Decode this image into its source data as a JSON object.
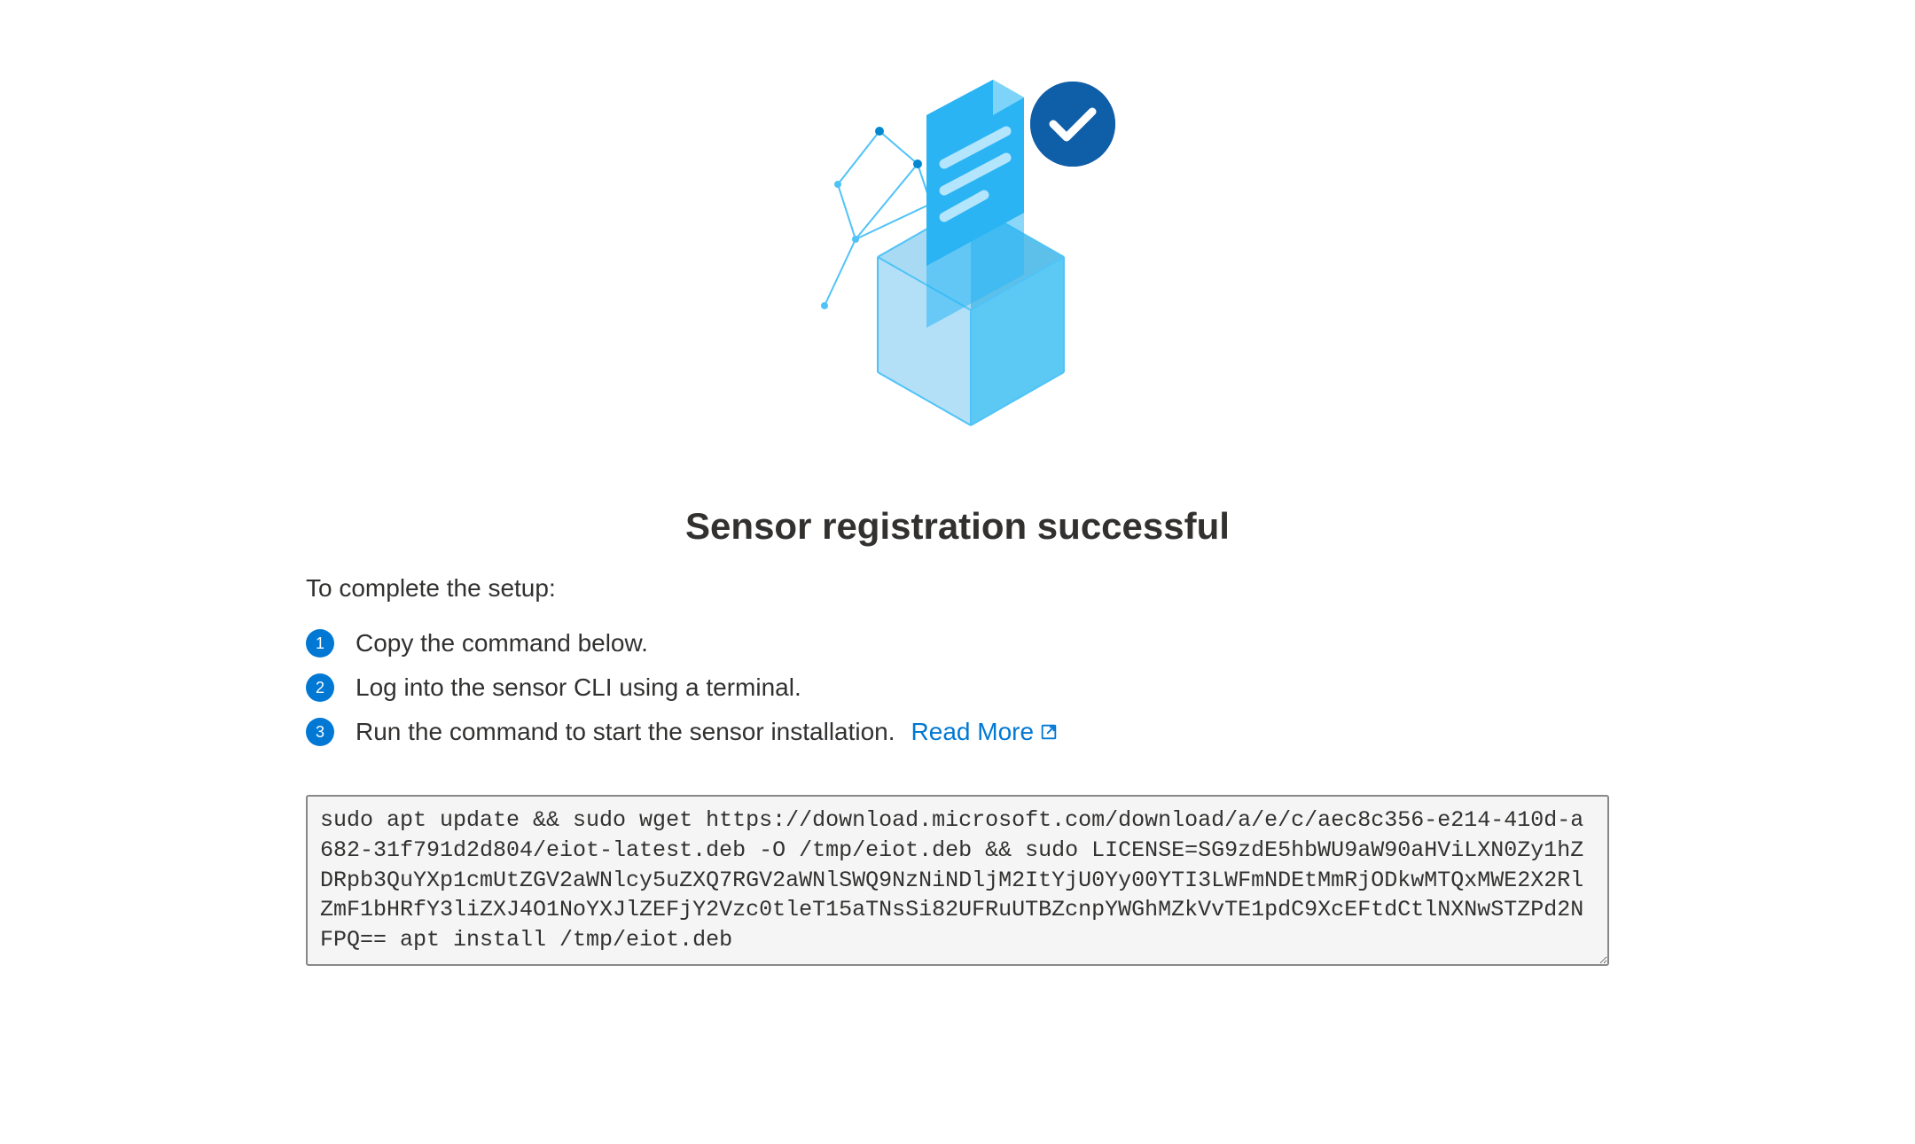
{
  "title": "Sensor registration successful",
  "subtitle": "To complete the setup:",
  "steps": [
    {
      "number": "1",
      "text": "Copy the command below."
    },
    {
      "number": "2",
      "text": "Log into the sensor CLI using a terminal."
    },
    {
      "number": "3",
      "text": "Run the command to start the sensor installation."
    }
  ],
  "readMore": {
    "label": "Read More"
  },
  "command": "sudo apt update && sudo wget https://download.microsoft.com/download/a/e/c/aec8c356-e214-410d-a682-31f791d2d804/eiot-latest.deb -O /tmp/eiot.deb && sudo LICENSE=SG9zdE5hbWU9aW90aHViLXN0Zy1hZDRpb3QuYXp1cmUtZGV2aWNlcy5uZXQ7RGV2aWNlSWQ9NzNiNDljM2ItYjU0Yy00YTI3LWFmNDEtMmRjODkwMTQxMWE2X2RlZmF1bHRfY3liZXJ4O1NoYXJlZEFjY2Vzc0tleT15aTNsSi82UFRuUTBZcnpYWGhMZkVvTE1pdC9XcEFtdCtlNXNwSTZPd2NFPQ== apt install /tmp/eiot.deb",
  "icons": {
    "checkmark": "checkmark-icon",
    "externalLink": "external-link-icon",
    "boxDocument": "box-document-icon"
  },
  "colors": {
    "primary": "#0078d4",
    "checkmarkBg": "#0f5ea8",
    "boxLight": "#b3e5fc",
    "boxMedium": "#5cc9f5",
    "docBlue": "#29b6f6",
    "textDark": "#323130"
  }
}
